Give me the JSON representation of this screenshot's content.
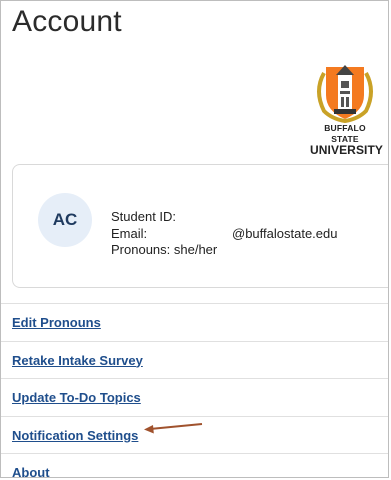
{
  "page": {
    "title": "Account"
  },
  "logo": {
    "line1": "BUFFALO STATE",
    "line2": "UNIVERSITY"
  },
  "profile": {
    "initials": "AC",
    "student_id_label": "Student ID:",
    "email_label": "Email:",
    "email_domain": "@buffalostate.edu",
    "pronouns_label": "Pronouns: she/her"
  },
  "links": [
    {
      "label": "Edit Pronouns"
    },
    {
      "label": "Retake Intake Survey"
    },
    {
      "label": "Update To-Do Topics"
    },
    {
      "label": "Notification Settings"
    },
    {
      "label": "About"
    }
  ],
  "colors": {
    "link": "#1f4e8c",
    "arrow": "#a0522d",
    "logo_orange": "#f47a20",
    "logo_gold": "#c9a227"
  }
}
